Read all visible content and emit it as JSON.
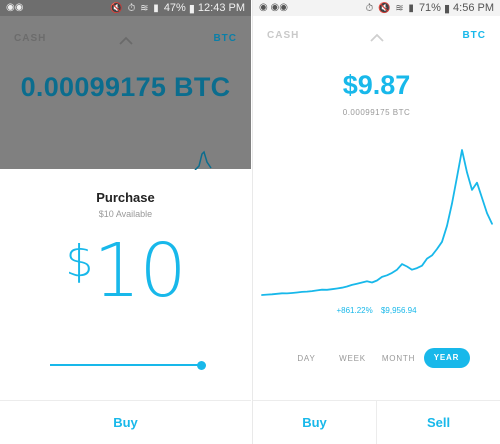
{
  "left": {
    "statusbar": {
      "voicemail_icon": "voicemail-icon",
      "battery": "47%",
      "time": "12:43 PM"
    },
    "nav": {
      "cash_label": "CASH",
      "btc_label": "BTC"
    },
    "btc_balance": "0.00099175 BTC",
    "purchase": {
      "title": "Purchase",
      "available": "$10 Available",
      "currency_symbol": "$",
      "amount": "10",
      "slider_fraction": 1.0
    },
    "actions": {
      "buy_label": "Buy"
    },
    "colors": {
      "accent": "#18b8ea",
      "dim": "#808080"
    }
  },
  "right": {
    "statusbar": {
      "battery": "71%",
      "time": "4:56 PM"
    },
    "nav": {
      "cash_label": "CASH",
      "btc_label": "BTC"
    },
    "usd_value": "$9.87",
    "btc_value": "0.00099175 BTC",
    "change_percent": "+861.22%",
    "btc_price": "$9,956.94",
    "periods": [
      "DAY",
      "WEEK",
      "MONTH",
      "YEAR"
    ],
    "active_period": "YEAR",
    "actions": {
      "buy_label": "Buy",
      "sell_label": "Sell"
    },
    "colors": {
      "accent": "#18b8ea"
    }
  },
  "chart_data": {
    "type": "line",
    "title": "",
    "xlabel": "",
    "ylabel": "",
    "grid": false,
    "series": [
      {
        "values": [
          1035,
          1080,
          1120,
          1180,
          1250,
          1230,
          1280,
          1350,
          1420,
          1460,
          1520,
          1610,
          1700,
          1690,
          1760,
          1850,
          1950,
          2100,
          2300,
          2450,
          2600,
          2750,
          2600,
          2850,
          3300,
          3500,
          3800,
          4200,
          4900,
          4600,
          4200,
          4400,
          4700,
          5600,
          6000,
          6800,
          7700,
          9700,
          12500,
          15800,
          19200,
          16400,
          14200,
          15100,
          13200,
          11300,
          9956.94
        ]
      }
    ]
  }
}
